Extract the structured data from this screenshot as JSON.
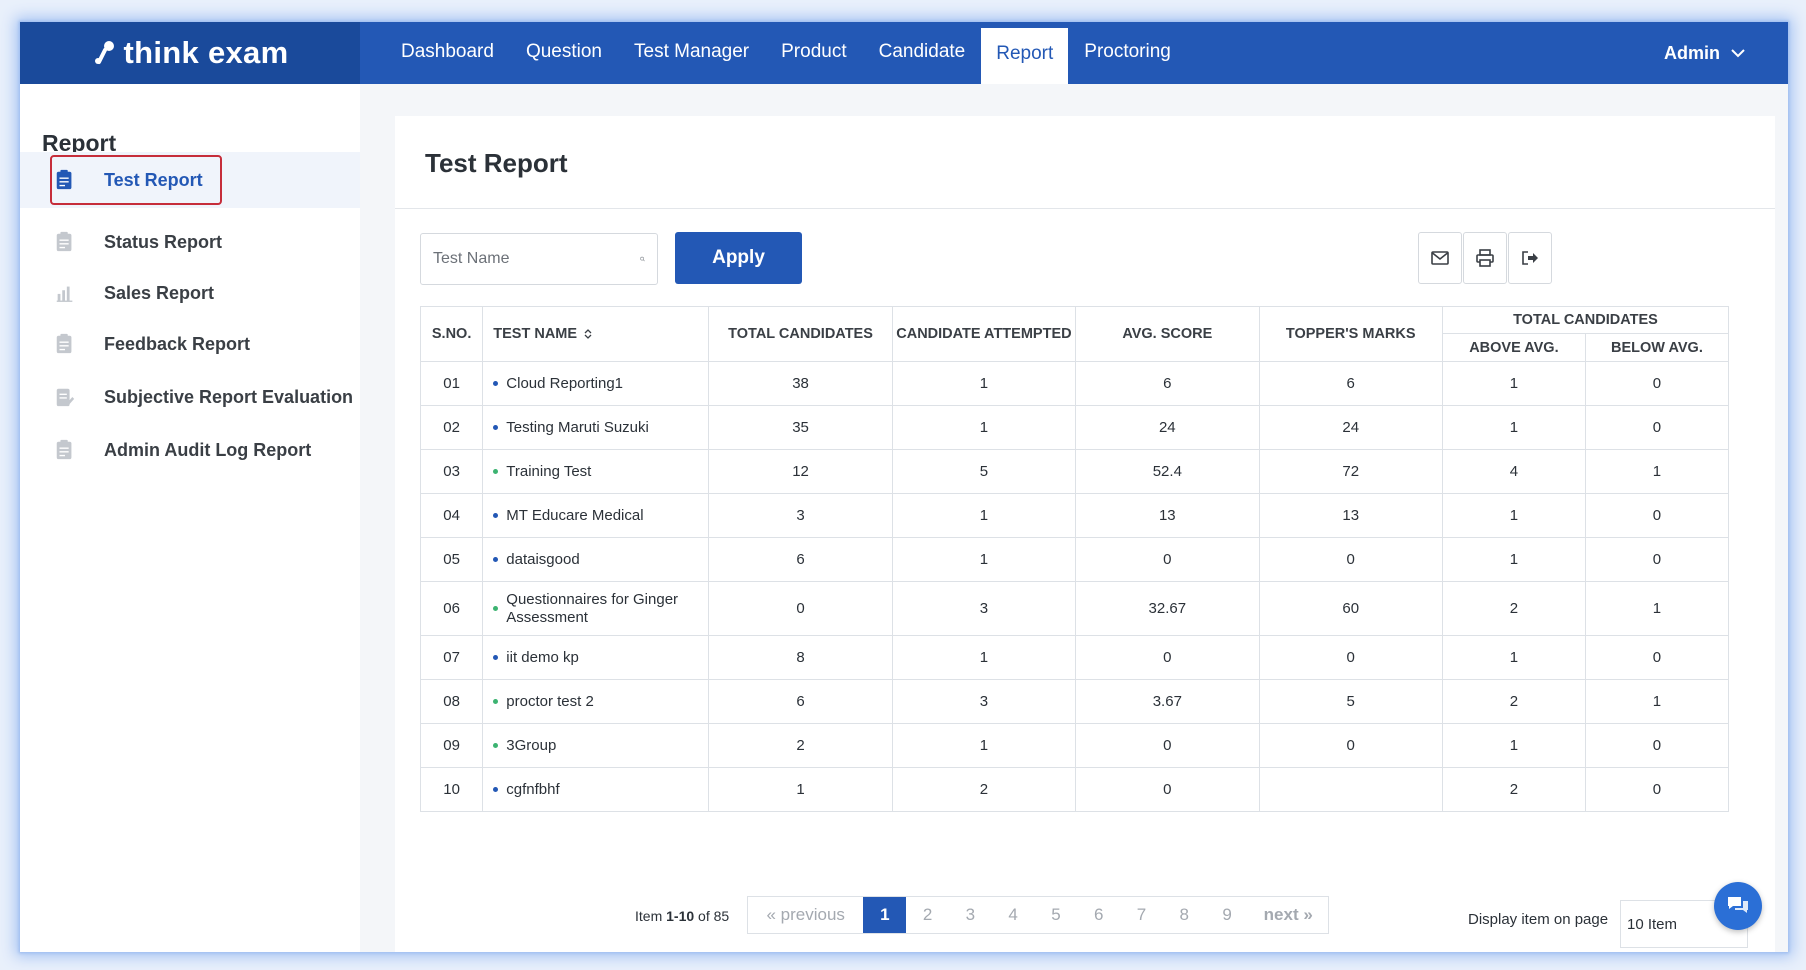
{
  "brand": {
    "logo_text": "think exam"
  },
  "nav": {
    "items": [
      {
        "label": "Dashboard",
        "active": false
      },
      {
        "label": "Question",
        "active": false
      },
      {
        "label": "Test Manager",
        "active": false
      },
      {
        "label": "Product",
        "active": false
      },
      {
        "label": "Candidate",
        "active": false
      },
      {
        "label": "Report",
        "active": true
      },
      {
        "label": "Proctoring",
        "active": false
      }
    ],
    "user": "Admin"
  },
  "sidebar": {
    "title": "Report",
    "items": [
      {
        "label": "Test Report",
        "icon": "clipboard-icon",
        "active": true
      },
      {
        "label": "Status Report",
        "icon": "clipboard-icon",
        "active": false
      },
      {
        "label": "Sales Report",
        "icon": "bar-chart-icon",
        "active": false
      },
      {
        "label": "Feedback Report",
        "icon": "clipboard-icon",
        "active": false
      },
      {
        "label": "Subjective Report Evaluation",
        "icon": "edit-document-icon",
        "active": false
      },
      {
        "label": "Admin Audit Log Report",
        "icon": "clipboard-icon",
        "active": false
      }
    ]
  },
  "main": {
    "title": "Test Report",
    "search_placeholder": "Test Name",
    "apply_label": "Apply",
    "tools": [
      "email-icon",
      "print-icon",
      "export-icon"
    ]
  },
  "table": {
    "headers": {
      "sno": "S.NO.",
      "test_name": "TEST NAME",
      "total_candidates": "TOTAL CANDIDATES",
      "candidate_attempted": "CANDIDATE ATTEMPTED",
      "avg_score": "AVG. SCORE",
      "toppers_marks": "TOPPER'S MARKS",
      "group_total": "TOTAL CANDIDATES",
      "above_avg": "ABOVE AVG.",
      "below_avg": "BELOW AVG."
    },
    "rows": [
      {
        "sno": "01",
        "name": "Cloud Reporting1",
        "dot": "#2358b5",
        "total": "38",
        "attempted": "1",
        "avg": "6",
        "topper": "6",
        "above": "1",
        "below": "0"
      },
      {
        "sno": "02",
        "name": "Testing Maruti Suzuki",
        "dot": "#2358b5",
        "total": "35",
        "attempted": "1",
        "avg": "24",
        "topper": "24",
        "above": "1",
        "below": "0"
      },
      {
        "sno": "03",
        "name": "Training Test",
        "dot": "#3cb371",
        "total": "12",
        "attempted": "5",
        "avg": "52.4",
        "topper": "72",
        "above": "4",
        "below": "1"
      },
      {
        "sno": "04",
        "name": "MT Educare Medical",
        "dot": "#2358b5",
        "total": "3",
        "attempted": "1",
        "avg": "13",
        "topper": "13",
        "above": "1",
        "below": "0"
      },
      {
        "sno": "05",
        "name": "dataisgood",
        "dot": "#2358b5",
        "total": "6",
        "attempted": "1",
        "avg": "0",
        "topper": "0",
        "above": "1",
        "below": "0"
      },
      {
        "sno": "06",
        "name": "Questionnaires for Ginger Assessment",
        "dot": "#3cb371",
        "total": "0",
        "attempted": "3",
        "avg": "32.67",
        "topper": "60",
        "above": "2",
        "below": "1"
      },
      {
        "sno": "07",
        "name": "iit demo kp",
        "dot": "#2358b5",
        "total": "8",
        "attempted": "1",
        "avg": "0",
        "topper": "0",
        "above": "1",
        "below": "0"
      },
      {
        "sno": "08",
        "name": "proctor test 2",
        "dot": "#3cb371",
        "total": "6",
        "attempted": "3",
        "avg": "3.67",
        "topper": "5",
        "above": "2",
        "below": "1"
      },
      {
        "sno": "09",
        "name": "3Group",
        "dot": "#3cb371",
        "total": "2",
        "attempted": "1",
        "avg": "0",
        "topper": "0",
        "above": "1",
        "below": "0"
      },
      {
        "sno": "10",
        "name": "cgfnfbhf",
        "dot": "#2358b5",
        "total": "1",
        "attempted": "2",
        "avg": "0",
        "topper": "",
        "above": "2",
        "below": "0"
      }
    ]
  },
  "pagination": {
    "info_prefix": "Item ",
    "info_range": "1-10",
    "info_suffix": " of 85",
    "prev_label": "« previous",
    "next_label": "next »",
    "pages": [
      "1",
      "2",
      "3",
      "4",
      "5",
      "6",
      "7",
      "8",
      "9"
    ],
    "current": "1",
    "display_label": "Display item on page",
    "display_value": "10 Item"
  },
  "colors": {
    "primary": "#2358b5",
    "logo_bg": "#1a4a9b",
    "active_outline": "#c62d3a"
  }
}
